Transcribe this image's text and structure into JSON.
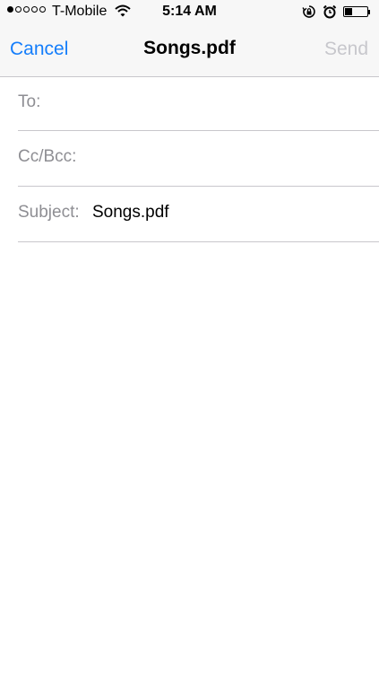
{
  "status_bar": {
    "signal_strength": "1 of 5",
    "carrier": "T-Mobile",
    "wifi_icon": "wifi-icon",
    "time": "5:14 AM",
    "orientation_lock_icon": "orientation-lock-icon",
    "alarm_icon": "alarm-icon",
    "battery_level": 0.35
  },
  "nav": {
    "cancel_label": "Cancel",
    "title": "Songs.pdf",
    "send_label": "Send",
    "accent_color": "#157efb",
    "disabled_color": "#c7c7cc"
  },
  "fields": {
    "to_label": "To:",
    "to_value": "",
    "cc_label": "Cc/Bcc:",
    "cc_value": "",
    "subject_label": "Subject:",
    "subject_value": "Songs.pdf"
  },
  "body": {
    "text": ""
  }
}
